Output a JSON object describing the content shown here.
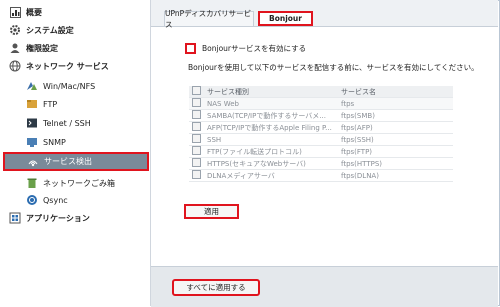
{
  "sidebar": {
    "items": [
      {
        "label": "概要",
        "icon": "overview-icon"
      },
      {
        "label": "システム設定",
        "icon": "gear-icon"
      },
      {
        "label": "権限設定",
        "icon": "user-icon"
      },
      {
        "label": "ネットワーク サービス",
        "icon": "globe-icon"
      },
      {
        "label": "Win/Mac/NFS",
        "icon": "windows-icon"
      },
      {
        "label": "FTP",
        "icon": "ftp-icon"
      },
      {
        "label": "Telnet / SSH",
        "icon": "terminal-icon"
      },
      {
        "label": "SNMP",
        "icon": "snmp-icon"
      },
      {
        "label": "サービス検出",
        "icon": "service-discovery-icon"
      },
      {
        "label": "ネットワークごみ箱",
        "icon": "recycle-bin-icon"
      },
      {
        "label": "Qsync",
        "icon": "qsync-icon"
      },
      {
        "label": "アプリケーション",
        "icon": "applications-icon"
      }
    ]
  },
  "tabs": [
    {
      "label": "UPnPディスカバリサービス"
    },
    {
      "label": "Bonjour"
    }
  ],
  "bonjour": {
    "enable_label": "Bonjourサービスを有効にする",
    "description": "Bonjourを使用して以下のサービスを配信する前に、サービスを有効にしてください。",
    "table": {
      "headers": [
        "サービス種別",
        "サービス名"
      ],
      "rows": [
        [
          "NAS Web",
          "ftps"
        ],
        [
          "SAMBA(TCP/IPで動作するサーバメ...",
          "ftps(SMB)"
        ],
        [
          "AFP(TCP/IPで動作するApple Filing P...",
          "ftps(AFP)"
        ],
        [
          "SSH",
          "ftps(SSH)"
        ],
        [
          "FTP(ファイル転送プロトコル)",
          "ftps(FTP)"
        ],
        [
          "HTTPS(セキュアなWebサーバ)",
          "ftps(HTTPS)"
        ],
        [
          "DLNAメディアサーバ",
          "ftps(DLNA)"
        ]
      ]
    },
    "apply_label": "適用"
  },
  "footer": {
    "apply_all_label": "すべてに適用する"
  },
  "colors": {
    "highlight": "#e0141e",
    "selected_bg": "#7a8a99",
    "footer_bg": "#e4e8ec"
  }
}
